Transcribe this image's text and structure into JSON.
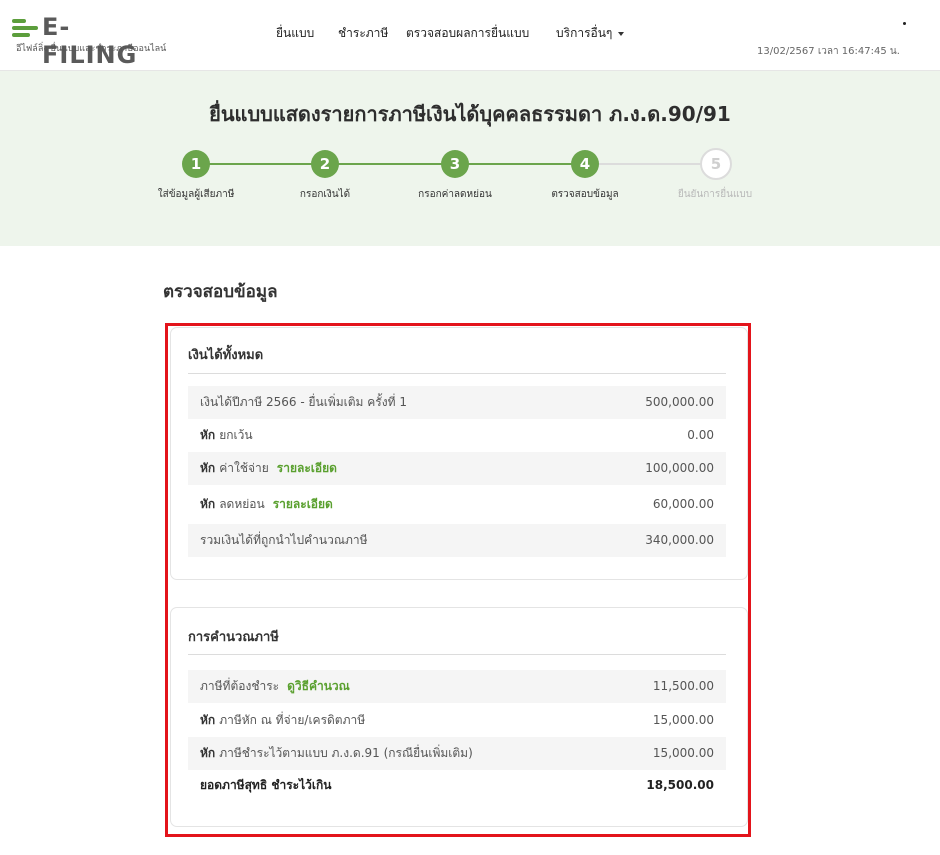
{
  "header": {
    "logo_text": "E-FILING",
    "logo_sub": "อีไฟล์ลิ่ง ยื่นแบบและชำระภาษีออนไลน์",
    "nav": {
      "file": "ยื่นแบบ",
      "pay": "ชำระภาษี",
      "check": "ตรวจสอบผลการยื่นแบบ",
      "services": "บริการอื่นๆ"
    },
    "datetime": "13/02/2567 เวลา 16:47:45 น."
  },
  "banner": {
    "title": "ยื่นแบบแสดงรายการภาษีเงินได้บุคคลธรรมดา ภ.ง.ด.90/91",
    "steps": [
      {
        "num": "1",
        "label": "ใส่ข้อมูลผู้เสียภาษี",
        "done": true
      },
      {
        "num": "2",
        "label": "กรอกเงินได้",
        "done": true
      },
      {
        "num": "3",
        "label": "กรอกค่าลดหย่อน",
        "done": true
      },
      {
        "num": "4",
        "label": "ตรวจสอบข้อมูล",
        "done": true
      },
      {
        "num": "5",
        "label": "ยืนยันการยื่นแบบ",
        "done": false
      }
    ]
  },
  "main": {
    "title": "ตรวจสอบข้อมูล",
    "income": {
      "title": "เงินได้ทั้งหมด",
      "rows": [
        {
          "prefix": "",
          "label": "เงินได้ปีภาษี 2566 - ยื่นเพิ่มเติม ครั้งที่ 1",
          "link": "",
          "value": "500,000.00"
        },
        {
          "prefix": "หัก",
          "label": "ยกเว้น",
          "link": "",
          "value": "0.00"
        },
        {
          "prefix": "หัก",
          "label": "ค่าใช้จ่าย",
          "link": "รายละเอียด",
          "value": "100,000.00"
        },
        {
          "prefix": "หัก",
          "label": "ลดหย่อน",
          "link": "รายละเอียด",
          "value": "60,000.00"
        },
        {
          "prefix": "",
          "label": "รวมเงินได้ที่ถูกนำไปคำนวณภาษี",
          "link": "",
          "value": "340,000.00"
        }
      ]
    },
    "tax": {
      "title": "การคำนวณภาษี",
      "rows": [
        {
          "prefix": "",
          "label": "ภาษีที่ต้องชำระ",
          "link": "ดูวิธีคำนวณ",
          "value": "11,500.00"
        },
        {
          "prefix": "หัก",
          "label": "ภาษีหัก ณ ที่จ่าย/เครดิตภาษี",
          "link": "",
          "value": "15,000.00"
        },
        {
          "prefix": "หัก",
          "label": "ภาษีชำระไว้ตามแบบ ภ.ง.ด.91 (กรณียื่นเพิ่มเติม)",
          "link": "",
          "value": "15,000.00"
        },
        {
          "prefix": "",
          "label": "ยอดภาษีสุทธิ ชำระไว้เกิน",
          "link": "",
          "value": "18,500.00"
        }
      ]
    }
  },
  "colors": {
    "brand_green": "#6ba54c",
    "banner_bg": "#eef5ec",
    "highlight_red": "#e3141b",
    "link_green": "#5aa02f"
  }
}
